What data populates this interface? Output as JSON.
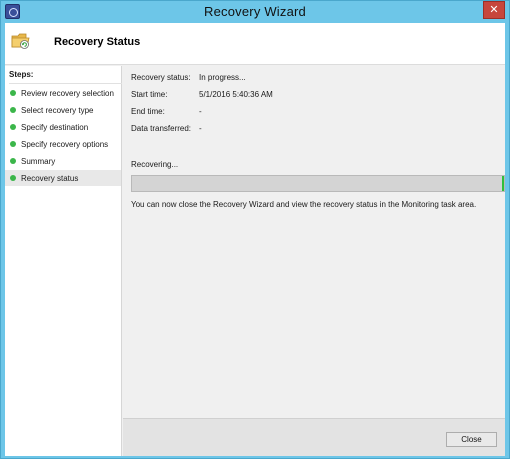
{
  "window": {
    "title": "Recovery Wizard",
    "close_glyph": "✕",
    "app_icon": "backup-app-icon"
  },
  "header": {
    "title": "Recovery Status",
    "icon": "folder-restore-icon"
  },
  "sidebar": {
    "steps_label": "Steps:",
    "items": [
      {
        "label": "Review recovery selection",
        "active": false
      },
      {
        "label": "Select recovery type",
        "active": false
      },
      {
        "label": "Specify destination",
        "active": false
      },
      {
        "label": "Specify recovery options",
        "active": false
      },
      {
        "label": "Summary",
        "active": false
      },
      {
        "label": "Recovery status",
        "active": true
      }
    ],
    "dot_color": "#3bb64a"
  },
  "status": {
    "recovery_status_label": "Recovery status:",
    "recovery_status_value": "In progress...",
    "start_time_label": "Start time:",
    "start_time_value": "5/1/2016 5:40:36 AM",
    "end_time_label": "End time:",
    "end_time_value": "-",
    "data_transferred_label": "Data transferred:",
    "data_transferred_value": "-",
    "recovering_text": "Recovering...",
    "progress_fraction": 0.0,
    "note": "You can now close the Recovery Wizard and view the recovery status in the Monitoring task area."
  },
  "footer": {
    "close_label": "Close"
  },
  "colors": {
    "titlebar": "#6dc6e8",
    "close_button": "#c7463c",
    "progress_accent": "#2fbf3b"
  }
}
